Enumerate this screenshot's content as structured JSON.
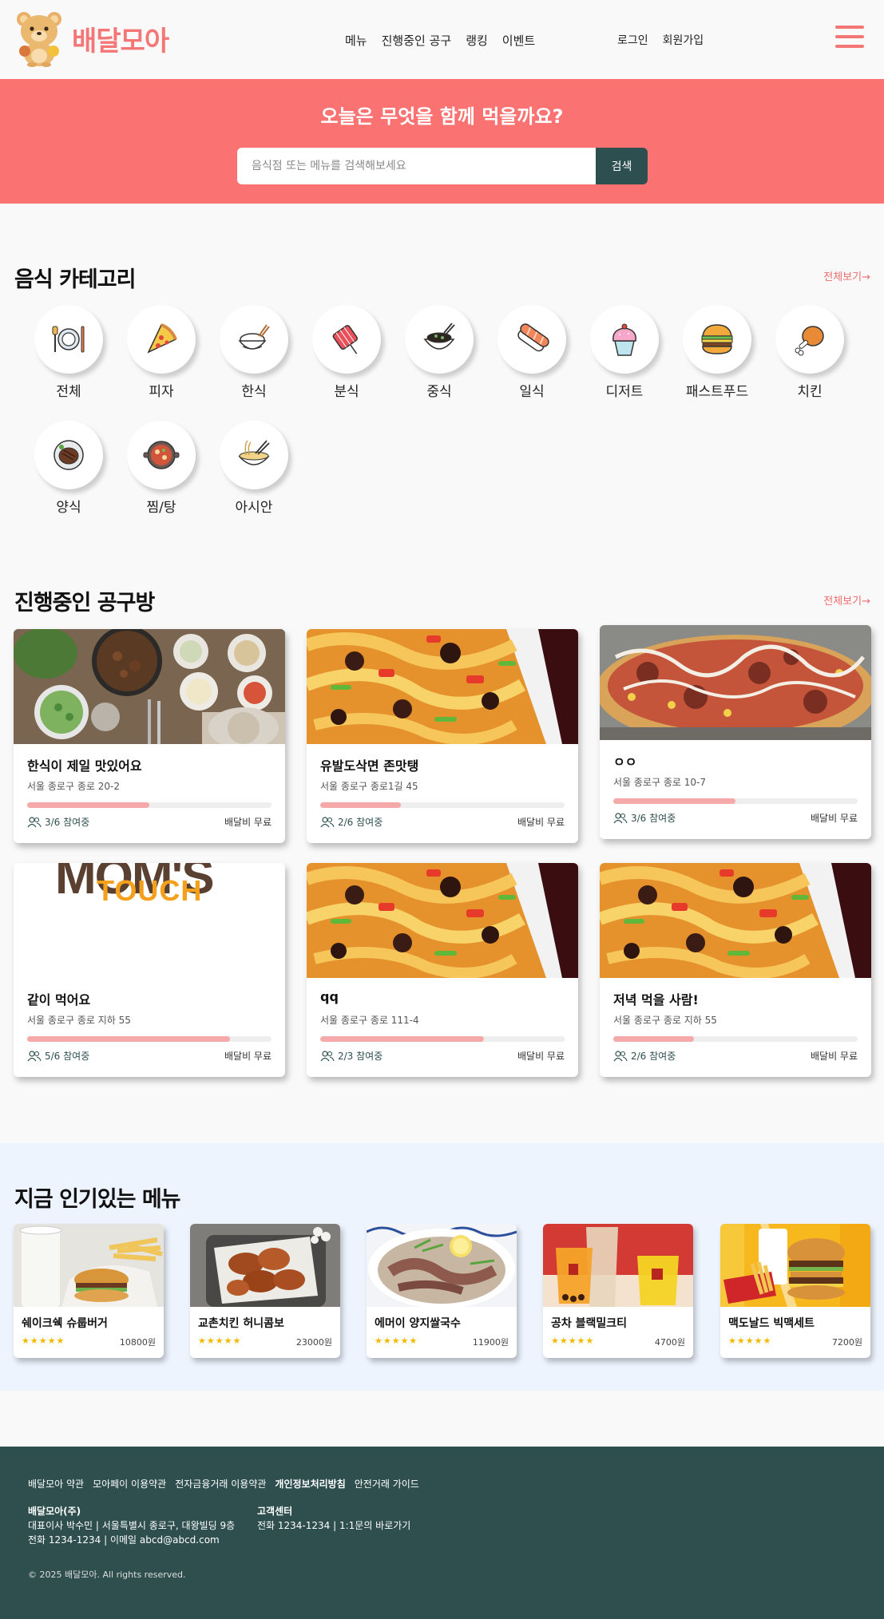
{
  "brand": {
    "name": "배달모아",
    "color": "#f47676"
  },
  "nav": {
    "items": [
      "메뉴",
      "진행중인 공구",
      "랭킹",
      "이벤트"
    ],
    "login": "로그인",
    "signup": "회원가입"
  },
  "hero": {
    "title": "오늘은 무엇을 함께 먹을까요?",
    "search_placeholder": "음식점 또는 메뉴를 검색해보세요",
    "search_button": "검색"
  },
  "categories": {
    "title": "음식 카테고리",
    "see_all": "전체보기→",
    "items": [
      {
        "label": "전체",
        "icon": "plate-cutlery-icon"
      },
      {
        "label": "피자",
        "icon": "pizza-icon"
      },
      {
        "label": "한식",
        "icon": "rice-bowl-icon"
      },
      {
        "label": "분식",
        "icon": "tteokbokki-icon"
      },
      {
        "label": "중식",
        "icon": "jjajang-icon"
      },
      {
        "label": "일식",
        "icon": "sushi-icon"
      },
      {
        "label": "디저트",
        "icon": "cupcake-icon"
      },
      {
        "label": "패스트푸드",
        "icon": "burger-icon"
      },
      {
        "label": "치킨",
        "icon": "chicken-icon"
      },
      {
        "label": "양식",
        "icon": "steak-icon"
      },
      {
        "label": "찜/탕",
        "icon": "stew-icon"
      },
      {
        "label": "아시안",
        "icon": "noodle-icon"
      }
    ]
  },
  "groups": {
    "title": "진행중인 공구방",
    "see_all": "전체보기→",
    "fee_label": "배달비 무료",
    "items": [
      {
        "title": "한식이 제일 맛있어요",
        "address": "서울 종로구 종로 20-2",
        "participants": "3/6 참여중",
        "progress": 0.5,
        "image": "korean-table-photo"
      },
      {
        "title": "유발도삭면 존맛탱",
        "address": "서울 종로구 종로1길 45",
        "participants": "2/6 참여중",
        "progress": 0.33,
        "image": "noodle-dish-photo"
      },
      {
        "title": "ㅇㅇ",
        "address": "서울 종로구 종로 10-7",
        "participants": "3/6 참여중",
        "progress": 0.5,
        "image": "pizza-photo"
      },
      {
        "title": "같이 먹어요",
        "address": "서울 종로구 종로 지하 55",
        "participants": "5/6 참여중",
        "progress": 0.83,
        "image": "moms-touch-logo",
        "logo_text": [
          "MOM'S",
          "TOUCH"
        ]
      },
      {
        "title": "qq",
        "address": "서울 종로구 종로 111-4",
        "participants": "2/3 참여중",
        "progress": 0.67,
        "image": "noodle-dish-photo"
      },
      {
        "title": "저녁 먹을 사람!",
        "address": "서울 종로구 종로 지하 55",
        "participants": "2/6 참여중",
        "progress": 0.33,
        "image": "noodle-dish-photo"
      }
    ]
  },
  "popular": {
    "title": "지금 인기있는 메뉴",
    "items": [
      {
        "name": "쉐이크쉑 슈룹버거",
        "stars": "★★★★★",
        "price": "10800원",
        "image": "burger-fries-photo"
      },
      {
        "name": "교촌치킨 허니콤보",
        "stars": "★★★★★",
        "price": "23000원",
        "image": "fried-chicken-photo"
      },
      {
        "name": "에머이 양지쌀국수",
        "stars": "★★★★★",
        "price": "11900원",
        "image": "pho-photo"
      },
      {
        "name": "공차 블랙밀크티",
        "stars": "★★★★★",
        "price": "4700원",
        "image": "milk-tea-photo"
      },
      {
        "name": "맥도날드 빅맥세트",
        "stars": "★★★★★",
        "price": "7200원",
        "image": "bigmac-photo"
      }
    ]
  },
  "footer": {
    "links": [
      "배달모아 약관",
      "모아페이 이용약관",
      "전자금융거래 이용약관",
      "개인정보처리방침",
      "안전거래 가이드"
    ],
    "company": {
      "name": "배달모아(주)",
      "line1": "대표이사 박수민 | 서울특별시 종로구, 대왕빌딩 9층",
      "line2": "전화 1234-1234 | 이메일 abcd@abcd.com"
    },
    "support": {
      "title": "고객센터",
      "line1": "전화 1234-1234 | 1:1문의 바로가기"
    },
    "copyright": "© 2025 배달모아. All rights reserved."
  },
  "colors": {
    "hero": "#fb7272",
    "accent": "#f47676",
    "dark": "#2f4f4f",
    "progress": "#f5a9a9"
  }
}
